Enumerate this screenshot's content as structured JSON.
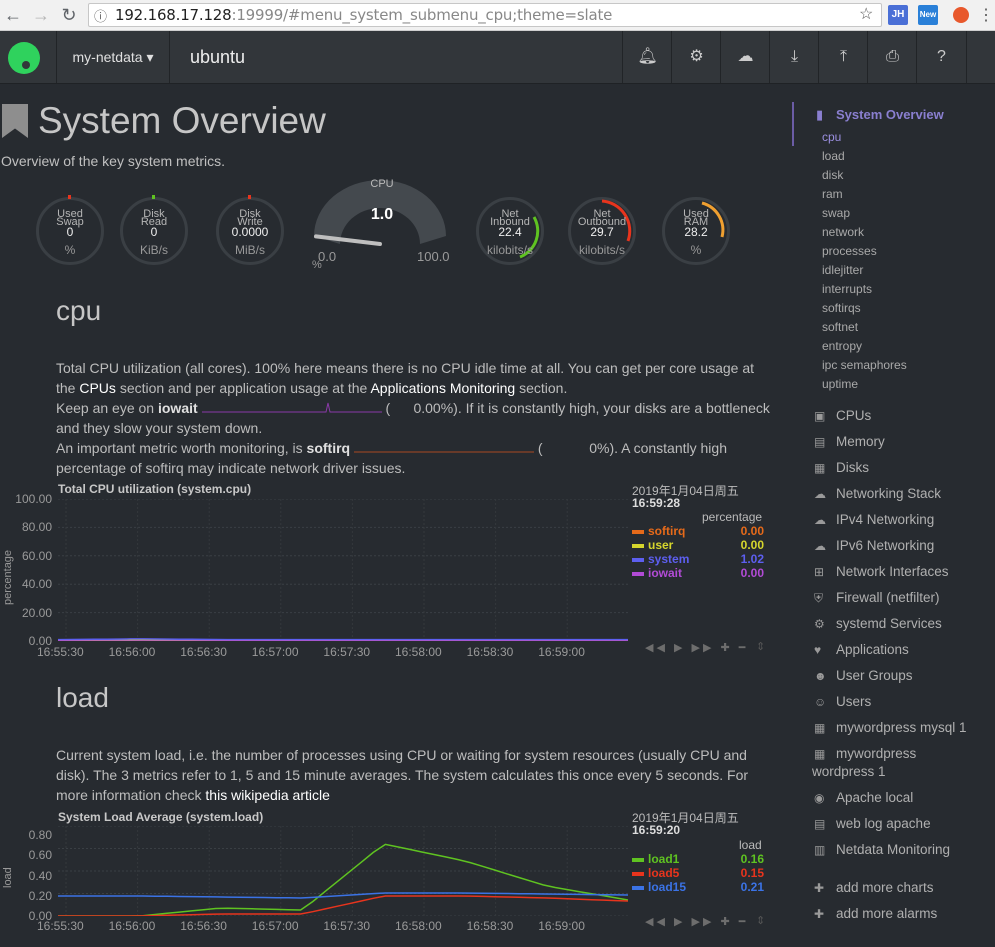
{
  "browser": {
    "url_host": "192.168.17.128",
    "url_rest": ":19999/#menu_system_submenu_cpu;theme=slate",
    "ext1": "JH",
    "ext2": "New"
  },
  "topbar": {
    "host_menu": "my-netdata ▾",
    "hostname": "ubuntu"
  },
  "page": {
    "title": "System Overview",
    "subtitle": "Overview of the key system metrics."
  },
  "gauges": [
    {
      "label1": "Used",
      "label2": "Swap",
      "value": "0",
      "unit": "%"
    },
    {
      "label1": "Disk",
      "label2": "Read",
      "value": "0",
      "unit": "KiB/s"
    },
    {
      "label1": "Disk",
      "label2": "Write",
      "value": "0.0000",
      "unit": "MiB/s"
    },
    {
      "label1": "Net",
      "label2": "Inbound",
      "value": "22.4",
      "unit": "kilobits/s"
    },
    {
      "label1": "Net",
      "label2": "Outbound",
      "value": "29.7",
      "unit": "kilobits/s"
    },
    {
      "label1": "Used",
      "label2": "RAM",
      "value": "28.2",
      "unit": "%"
    }
  ],
  "cpu_gauge": {
    "title": "CPU",
    "value": "1.0",
    "min": "0.0",
    "max": "100.0",
    "unit": "%",
    "level": 1.0
  },
  "cpu_section": {
    "title": "cpu",
    "p1a": "Total CPU utilization (all cores). 100% here means there is no CPU idle time at all. You can get per core usage at",
    "p1b": "the",
    "link_cpus": "CPUs",
    "p1c": "section and per application usage at the",
    "link_apps": "Applications Monitoring",
    "p1d": "section.",
    "p2a": "Keep an eye on",
    "iowait": "iowait",
    "p2b": "(",
    "p2val": "0.00%",
    "p2c": "). If it is constantly high, your disks are a bottleneck",
    "p2d": "and they slow your system down.",
    "p3a": "An important metric worth monitoring, is",
    "softirq": "softirq",
    "p3b": "(",
    "p3val": "0%",
    "p3c": "). A constantly high",
    "p3d": "percentage of softirq may indicate network driver issues."
  },
  "cpu_chart": {
    "title": "Total CPU utilization (system.cpu)",
    "date": "2019年1月04日周五",
    "time": "16:59:28",
    "units": "percentage",
    "ylabel": "percentage",
    "yticks": [
      "100.00",
      "80.00",
      "60.00",
      "40.00",
      "20.00",
      "0.00"
    ],
    "xticks": [
      "16:55:30",
      "16:56:00",
      "16:56:30",
      "16:57:00",
      "16:57:30",
      "16:58:00",
      "16:58:30",
      "16:59:00"
    ],
    "legend": [
      {
        "name": "softirq",
        "value": "0.00",
        "color": "#e66a1a"
      },
      {
        "name": "user",
        "value": "0.00",
        "color": "#d6d62d"
      },
      {
        "name": "system",
        "value": "1.02",
        "color": "#5d5ff0"
      },
      {
        "name": "iowait",
        "value": "0.00",
        "color": "#b24bd6"
      }
    ],
    "controls": "◀◀ ▶ ▶▶ ✚ ━"
  },
  "load_section": {
    "title": "load",
    "p1": "Current system load, i.e. the number of processes using CPU or waiting for system resources (usually CPU and",
    "p2": "disk). The 3 metrics refer to 1, 5 and 15 minute averages. The system calculates this once every 5 seconds. For",
    "p3": "more information check",
    "link": "this wikipedia article"
  },
  "load_chart": {
    "title": "System Load Average (system.load)",
    "date": "2019年1月04日周五",
    "time": "16:59:20",
    "units": "load",
    "ylabel": "load",
    "yticks": [
      "0.80",
      "0.60",
      "0.40",
      "0.20",
      "0.00"
    ],
    "xticks": [
      "16:55:30",
      "16:56:00",
      "16:56:30",
      "16:57:00",
      "16:57:30",
      "16:58:00",
      "16:58:30",
      "16:59:00"
    ],
    "legend": [
      {
        "name": "load1",
        "value": "0.16",
        "color": "#5fc321"
      },
      {
        "name": "load5",
        "value": "0.15",
        "color": "#e8341d"
      },
      {
        "name": "load15",
        "value": "0.21",
        "color": "#3b73e6"
      }
    ],
    "controls": "◀◀ ▶ ▶▶ ✚ ━"
  },
  "chart_data": [
    {
      "type": "line",
      "title": "Total CPU utilization (system.cpu)",
      "ylabel": "percentage",
      "ylim": [
        0,
        100
      ],
      "x": [
        "16:55:30",
        "16:56:00",
        "16:56:30",
        "16:57:00",
        "16:57:30",
        "16:58:00",
        "16:58:30",
        "16:59:00"
      ],
      "series": [
        {
          "name": "softirq",
          "values": [
            0,
            0,
            0,
            0,
            0,
            0,
            0,
            0
          ]
        },
        {
          "name": "user",
          "values": [
            0.5,
            1,
            0.5,
            0.5,
            0.5,
            0.5,
            0.5,
            0.5
          ]
        },
        {
          "name": "system",
          "values": [
            1,
            1.5,
            1,
            1,
            1,
            1,
            1,
            1
          ]
        },
        {
          "name": "iowait",
          "values": [
            0,
            0,
            0,
            0,
            0,
            0,
            0,
            0
          ]
        }
      ]
    },
    {
      "type": "line",
      "title": "System Load Average (system.load)",
      "ylabel": "load",
      "ylim": [
        0,
        0.9
      ],
      "x": [
        "16:55:30",
        "16:56:00",
        "16:56:30",
        "16:57:00",
        "16:57:30",
        "16:58:00",
        "16:58:30",
        "16:59:00"
      ],
      "series": [
        {
          "name": "load1",
          "values": [
            0,
            0,
            0.08,
            0.06,
            0.72,
            0.55,
            0.3,
            0.16
          ]
        },
        {
          "name": "load5",
          "values": [
            0,
            0,
            0.02,
            0.02,
            0.2,
            0.2,
            0.18,
            0.15
          ]
        },
        {
          "name": "load15",
          "values": [
            0.2,
            0.2,
            0.19,
            0.18,
            0.23,
            0.23,
            0.22,
            0.21
          ]
        }
      ]
    }
  ],
  "sidebar": {
    "title": "System Overview",
    "subitems": [
      "cpu",
      "load",
      "disk",
      "ram",
      "swap",
      "network",
      "processes",
      "idlejitter",
      "interrupts",
      "softirqs",
      "softnet",
      "entropy",
      "ipc semaphores",
      "uptime"
    ],
    "items": [
      {
        "icon": "▣",
        "label": "CPUs"
      },
      {
        "icon": "▤",
        "label": "Memory"
      },
      {
        "icon": "▦",
        "label": "Disks"
      },
      {
        "icon": "☁",
        "label": "Networking Stack"
      },
      {
        "icon": "☁",
        "label": "IPv4 Networking"
      },
      {
        "icon": "☁",
        "label": "IPv6 Networking"
      },
      {
        "icon": "⊞",
        "label": "Network Interfaces"
      },
      {
        "icon": "⛨",
        "label": "Firewall (netfilter)"
      },
      {
        "icon": "⚙",
        "label": "systemd Services"
      },
      {
        "icon": "♥",
        "label": "Applications"
      },
      {
        "icon": "☻",
        "label": "User Groups"
      },
      {
        "icon": "☺",
        "label": "Users"
      },
      {
        "icon": "▦",
        "label": "mywordpress mysql 1"
      },
      {
        "icon": "▦",
        "label": "mywordpress"
      },
      {
        "icon": "◉",
        "label": "Apache local"
      },
      {
        "icon": "▤",
        "label": "web log apache"
      },
      {
        "icon": "▥",
        "label": "Netdata Monitoring"
      },
      {
        "icon": "✚",
        "label": "add more charts"
      },
      {
        "icon": "✚",
        "label": "add more alarms"
      }
    ],
    "wrap_text": "wordpress 1"
  }
}
